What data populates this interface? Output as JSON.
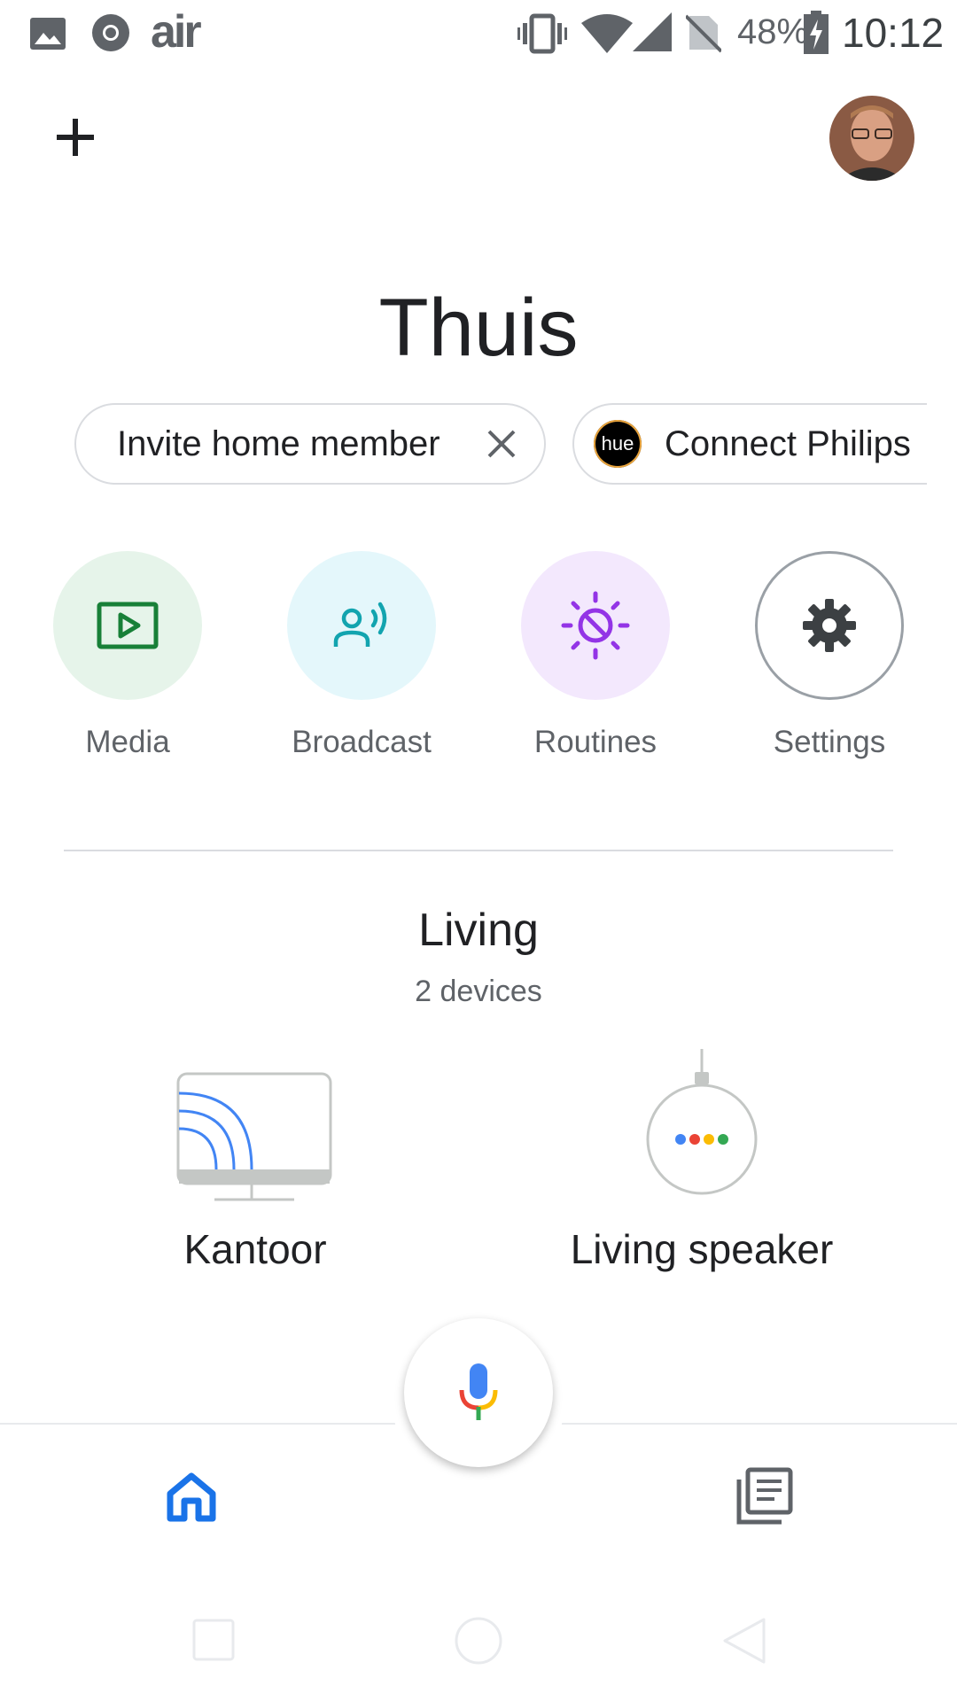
{
  "status_bar": {
    "battery": "48%",
    "time": "10:12",
    "icons": [
      "gallery-icon",
      "chrome-icon",
      "air-app-icon",
      "vibrate-icon",
      "wifi-icon",
      "signal-icon",
      "no-sim-icon",
      "battery-charging-icon"
    ],
    "air_label": "air"
  },
  "header": {
    "home_name": "Thuis",
    "add_icon": "plus-icon",
    "avatar_icon": "account-avatar"
  },
  "chips": {
    "invite_label": "Invite home member",
    "hue_label": "Connect Philips",
    "hue_logo_text": "hue"
  },
  "actions": {
    "media": "Media",
    "broadcast": "Broadcast",
    "routines": "Routines",
    "settings": "Settings"
  },
  "room": {
    "name": "Living",
    "count": "2 devices"
  },
  "devices": [
    {
      "label": "Kantoor",
      "icon": "chromecast-tv-icon"
    },
    {
      "label": "Living speaker",
      "icon": "google-home-mini-icon"
    }
  ],
  "bottom_nav": {
    "items": [
      "home-icon",
      "feed-icon"
    ],
    "mic": "mic-icon"
  },
  "colors": {
    "accent_blue": "#1a73e8",
    "media_green": "#188038",
    "broadcast_teal": "#12a4af",
    "routines_purple": "#9334e6"
  }
}
